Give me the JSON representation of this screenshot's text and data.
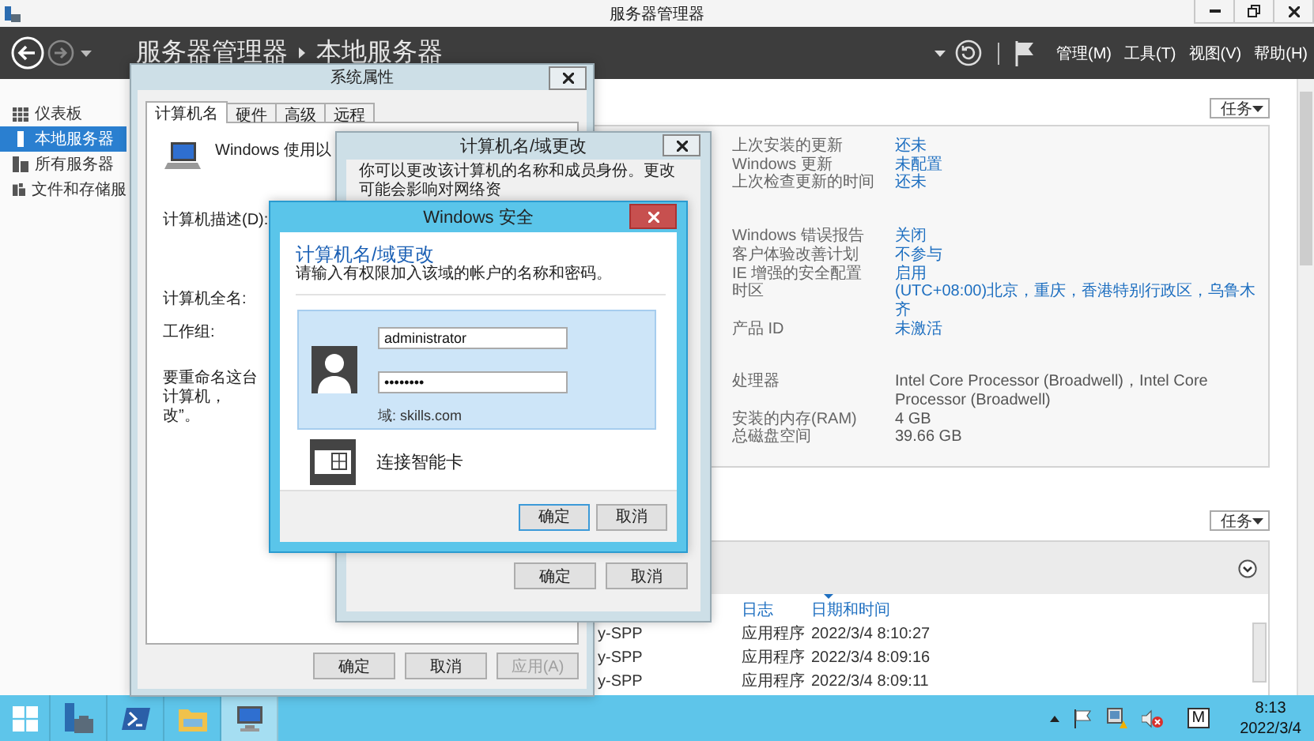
{
  "window": {
    "title": "服务器管理器"
  },
  "toolbar": {
    "breadcrumb": [
      "服务器管理器",
      "本地服务器"
    ],
    "menus": [
      "管理(M)",
      "工具(T)",
      "视图(V)",
      "帮助(H)"
    ]
  },
  "sidebar": {
    "items": [
      {
        "kind": "dashboard",
        "label": "仪表板",
        "selected": false
      },
      {
        "kind": "local",
        "label": "本地服务器",
        "selected": true
      },
      {
        "kind": "all",
        "label": "所有服务器",
        "selected": false
      },
      {
        "kind": "storage",
        "label": "文件和存储服",
        "selected": false
      }
    ]
  },
  "properties": {
    "tasks": "任务",
    "groups": [
      [
        {
          "label": "上次安装的更新",
          "value": "还未",
          "link": true
        },
        {
          "label": "Windows 更新",
          "value": "未配置",
          "link": true
        },
        {
          "label": "上次检查更新的时间",
          "value": "还未",
          "link": true
        }
      ],
      [
        {
          "label": "Windows 错误报告",
          "value": "关闭",
          "link": true
        },
        {
          "label": "客户体验改善计划",
          "value": "不参与",
          "link": true
        },
        {
          "label": "IE 增强的安全配置",
          "value": "启用",
          "link": true
        },
        {
          "label": "时区",
          "value": "(UTC+08:00)北京，重庆，香港特别行政区，乌鲁木齐",
          "link": true
        },
        {
          "label": "产品 ID",
          "value": "未激活",
          "link": true
        }
      ],
      [
        {
          "label": "处理器",
          "value": "Intel Core Processor (Broadwell)，Intel Core Processor (Broadwell)",
          "link": false
        },
        {
          "label": "安装的内存(RAM)",
          "value": "4 GB",
          "link": false
        },
        {
          "label": "总磁盘空间",
          "value": "39.66 GB",
          "link": false
        }
      ]
    ]
  },
  "events": {
    "tasks": "任务",
    "columns": [
      {
        "label": "日志",
        "sorted": false
      },
      {
        "label": "日期和时间",
        "sorted": true
      }
    ],
    "rows": [
      {
        "column_1": "y-SPP",
        "log": "应用程序",
        "time": "2022/3/4 8:10:27"
      },
      {
        "column_1": "y-SPP",
        "log": "应用程序",
        "time": "2022/3/4 8:09:16"
      },
      {
        "column_1": "y-SPP",
        "log": "应用程序",
        "time": "2022/3/4 8:09:11"
      }
    ]
  },
  "system_properties": {
    "title": "系统属性",
    "tabs": [
      {
        "label": "计算机名",
        "selected": true
      },
      {
        "label": "硬件",
        "selected": false
      },
      {
        "label": "高级",
        "selected": false
      },
      {
        "label": "远程",
        "selected": false
      }
    ],
    "intro": "Windows 使用以",
    "description_label": "计算机描述(D):",
    "full_name_label": "计算机全名:",
    "workgroup_label": "工作组:",
    "rename_lines": [
      "要重命名这台计算机，",
      "改”。"
    ],
    "buttons": [
      {
        "label": "确定",
        "disabled": false
      },
      {
        "label": "取消",
        "disabled": false
      },
      {
        "label": "应用(A)",
        "disabled": true
      }
    ]
  },
  "name_change": {
    "title": "计算机名/域更改",
    "intro": "你可以更改该计算机的名称和成员身份。更改可能会影响对网络资",
    "buttons": [
      "确定",
      "取消"
    ]
  },
  "security": {
    "title": "Windows 安全",
    "heading": "计算机名/域更改",
    "subtitle": "请输入有权限加入该域的帐户的名称和密码。",
    "credential": {
      "selected": true,
      "username": "administrator",
      "password": "••••••••",
      "domain": "域: skills.com"
    },
    "smartcard": {
      "selected": false,
      "label": "连接智能卡"
    },
    "buttons": [
      {
        "label": "确定",
        "default": true
      },
      {
        "label": "取消",
        "default": false
      }
    ]
  },
  "taskbar": {
    "apps": [
      {
        "kind": "start",
        "selected": false
      },
      {
        "kind": "server-manager",
        "selected": false
      },
      {
        "kind": "powershell",
        "selected": false
      },
      {
        "kind": "explorer",
        "selected": false
      },
      {
        "kind": "system",
        "selected": true
      }
    ],
    "ime": "M",
    "time": "8:13",
    "date": "2022/3/4"
  }
}
